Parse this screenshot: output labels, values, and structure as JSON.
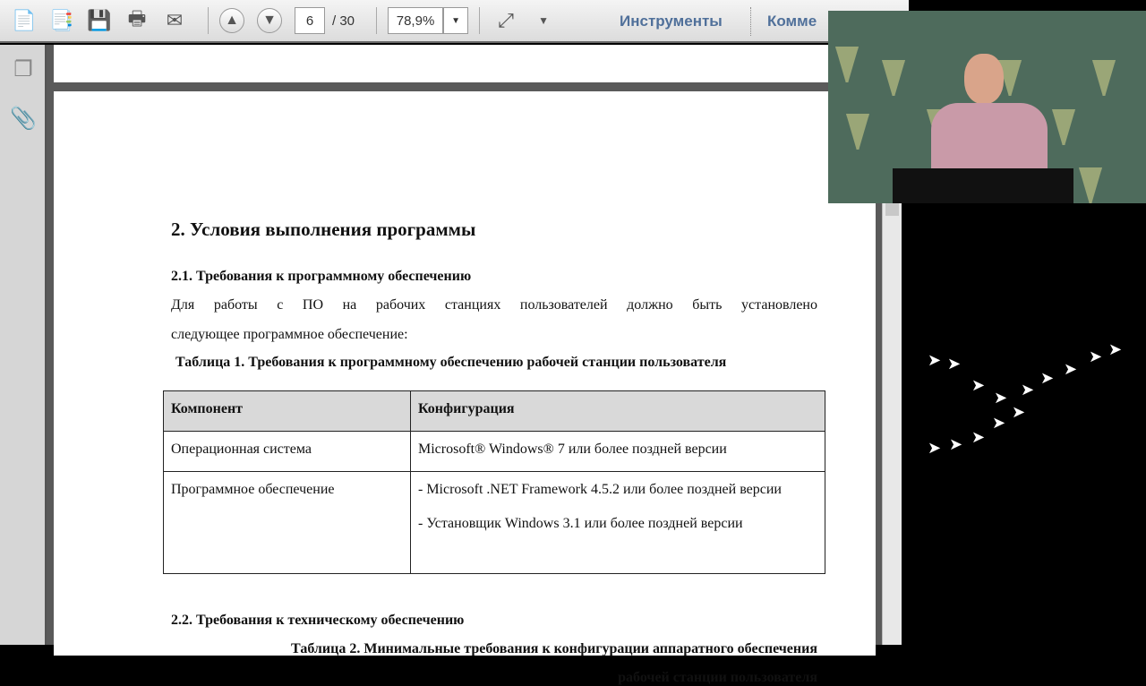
{
  "toolbar": {
    "page_current": "6",
    "page_total": "/ 30",
    "zoom": "78,9%",
    "tools_label": "Инструменты",
    "comments_label": "Комме"
  },
  "document": {
    "section_title": "2.      Условия выполнения программы",
    "sub1": "2.1.    Требования к программному обеспечению",
    "para1": "Для работы с ПО на рабочих станциях пользователей должно быть установлено",
    "para2": "следующее программное обеспечение:",
    "table1_caption": "Таблица 1. Требования к программному обеспечению рабочей станции пользователя",
    "table1": {
      "headers": [
        "Компонент",
        "Конфигурация"
      ],
      "rows": [
        [
          "Операционная система",
          "Microsoft® Windows® 7 или более поздней версии"
        ],
        [
          "Программное обеспечение",
          "- Microsoft .NET Framework 4.5.2 или более поздней версии",
          "- Установщик Windows 3.1 или более поздней версии"
        ]
      ]
    },
    "sub2": "2.2.     Требования к техническому обеспечению",
    "table2_caption_line1": "Таблица 2. Минимальные требования к конфигурации аппаратного обеспечения",
    "table2_caption_line2": "рабочей станции пользователя"
  }
}
